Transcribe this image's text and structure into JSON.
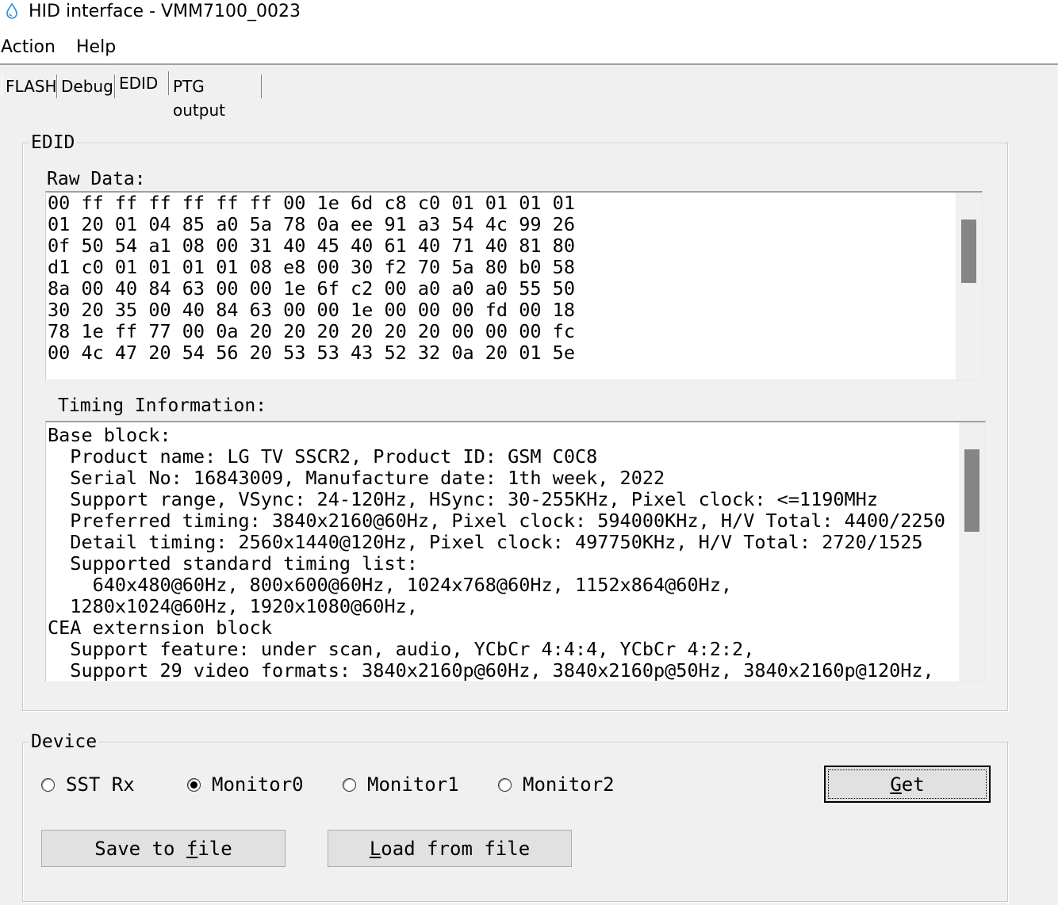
{
  "window": {
    "title": "HID interface - VMM7100_0023"
  },
  "menu": {
    "items": [
      "Action",
      "Help"
    ]
  },
  "tabs": [
    {
      "label": "FLASH",
      "active": false
    },
    {
      "label": "Debug",
      "active": false
    },
    {
      "label": "EDID",
      "active": true
    },
    {
      "label": "PTG output",
      "active": false
    }
  ],
  "edid": {
    "group_title": "EDID",
    "raw_label": "Raw Data:",
    "raw_lines": [
      "00 ff ff ff ff ff ff 00 1e 6d c8 c0 01 01 01 01",
      "01 20 01 04 85 a0 5a 78 0a ee 91 a3 54 4c 99 26",
      "0f 50 54 a1 08 00 31 40 45 40 61 40 71 40 81 80",
      "d1 c0 01 01 01 01 08 e8 00 30 f2 70 5a 80 b0 58",
      "8a 00 40 84 63 00 00 1e 6f c2 00 a0 a0 a0 55 50",
      "30 20 35 00 40 84 63 00 00 1e 00 00 00 fd 00 18",
      "78 1e ff 77 00 0a 20 20 20 20 20 20 00 00 00 fc",
      "00 4c 47 20 54 56 20 53 53 43 52 32 0a 20 01 5e"
    ],
    "timing_label": "Timing Information:",
    "timing_lines": [
      "Base block:",
      "  Product name: LG TV SSCR2, Product ID: GSM C0C8",
      "  Serial No: 16843009, Manufacture date: 1th week, 2022",
      "  Support range, VSync: 24-120Hz, HSync: 30-255KHz, Pixel clock: <=1190MHz",
      "  Preferred timing: 3840x2160@60Hz, Pixel clock: 594000KHz, H/V Total: 4400/2250",
      "  Detail timing: 2560x1440@120Hz, Pixel clock: 497750KHz, H/V Total: 2720/1525",
      "  Supported standard timing list:",
      "    640x480@60Hz, 800x600@60Hz, 1024x768@60Hz, 1152x864@60Hz,",
      "  1280x1024@60Hz, 1920x1080@60Hz,",
      "CEA externsion block",
      "  Support feature: under scan, audio, YCbCr 4:4:4, YCbCr 4:2:2,",
      "  Support 29 video formats: 3840x2160p@60Hz, 3840x2160p@50Hz, 3840x2160p@120Hz,"
    ]
  },
  "device": {
    "group_title": "Device",
    "options": [
      {
        "label": "SST Rx",
        "checked": false
      },
      {
        "label": "Monitor0",
        "checked": true
      },
      {
        "label": "Monitor1",
        "checked": false
      },
      {
        "label": "Monitor2",
        "checked": false
      }
    ],
    "get_label": "Get",
    "save_label": "Save to file",
    "load_label": "Load from file"
  }
}
